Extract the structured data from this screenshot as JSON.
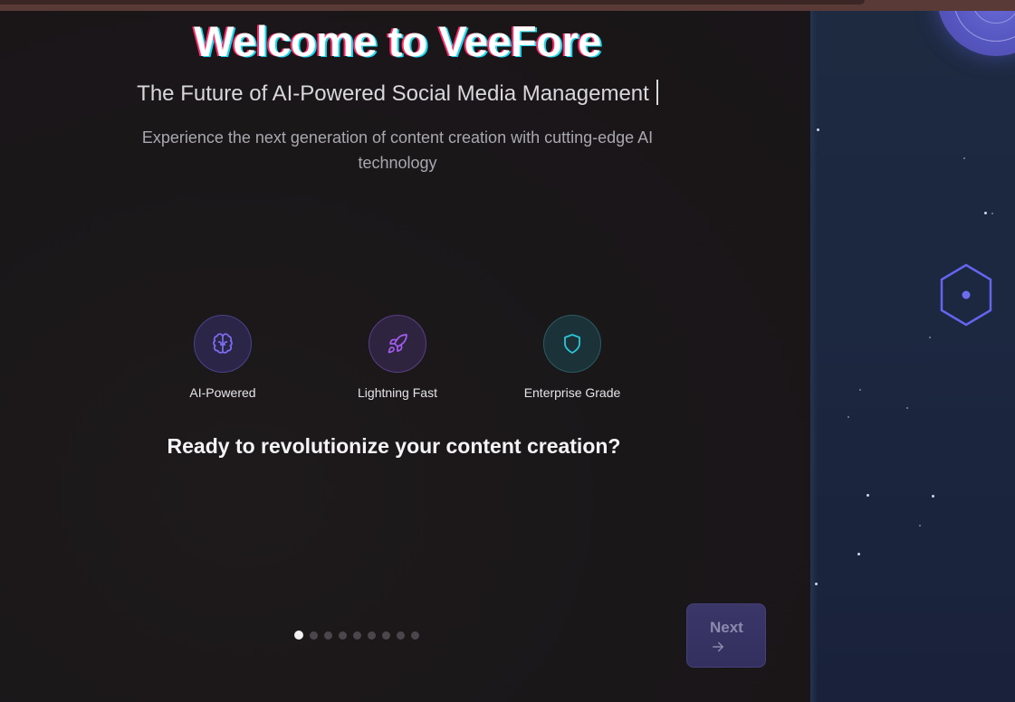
{
  "header": {
    "title": "Welcome to VeeFore",
    "subtitle": "The Future of AI-Powered Social Media Management",
    "description": "Experience the next generation of content creation with cutting-edge AI technology"
  },
  "features": [
    {
      "label": "AI-Powered",
      "icon": "brain-icon",
      "color": "#7b6cf2"
    },
    {
      "label": "Lightning Fast",
      "icon": "rocket-icon",
      "color": "#a15cf0"
    },
    {
      "label": "Enterprise Grade",
      "icon": "shield-icon",
      "color": "#2bc6d8"
    }
  ],
  "cta": {
    "question": "Ready to revolutionize your content creation?"
  },
  "pagination": {
    "total": 9,
    "current": 1
  },
  "navigation": {
    "next_label": "Next",
    "next_icon": "arrow-right-icon"
  },
  "colors": {
    "background": "#1a1618",
    "side_panel": "#1c2740",
    "accent": "#5b5be0"
  }
}
